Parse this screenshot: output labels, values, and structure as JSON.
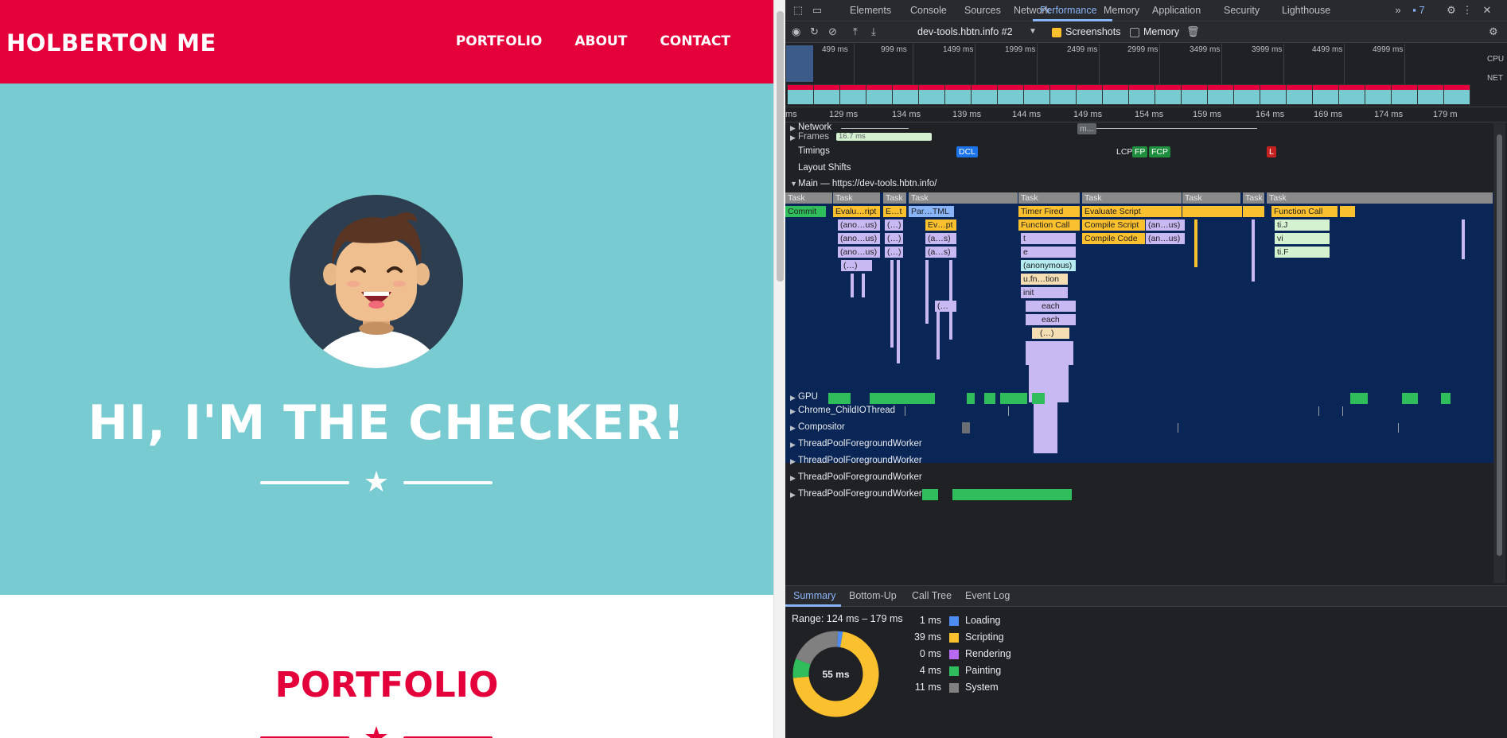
{
  "site": {
    "brand": "HOLBERTON ME",
    "nav": [
      "PORTFOLIO",
      "ABOUT",
      "CONTACT"
    ],
    "hero_title": "HI, I'M THE CHECKER!",
    "section_title": "PORTFOLIO",
    "colors": {
      "primary": "#e3003b",
      "hero_bg": "#78ccd1",
      "avatar_bg": "#2c3e50"
    }
  },
  "devtools": {
    "tabs": [
      "Elements",
      "Console",
      "Sources",
      "Network",
      "Performance",
      "Memory",
      "Application",
      "Security",
      "Lighthouse"
    ],
    "active_tab": "Performance",
    "issues_count": "7",
    "recording_target": "dev-tools.hbtn.info #2",
    "screenshots_label": "Screenshots",
    "screenshots_checked": true,
    "memory_label": "Memory",
    "memory_checked": false,
    "overview_ticks": [
      "499 ms",
      "999 ms",
      "1499 ms",
      "1999 ms",
      "2499 ms",
      "2999 ms",
      "3499 ms",
      "3999 ms",
      "4499 ms",
      "4999 ms"
    ],
    "overview_labels": {
      "cpu": "CPU",
      "net": "NET"
    },
    "ruler_ticks": [
      "ms",
      "129 ms",
      "134 ms",
      "139 ms",
      "144 ms",
      "149 ms",
      "154 ms",
      "159 ms",
      "164 ms",
      "169 ms",
      "174 ms",
      "179 m"
    ],
    "tracks": {
      "network": "Network",
      "network_item": "m...",
      "frames": "Frames",
      "frames_value": "16.7 ms",
      "timings": "Timings",
      "timing_markers": [
        "DCL",
        "LCP",
        "FP",
        "FCP",
        "L"
      ],
      "layout_shifts": "Layout Shifts",
      "main": "Main — https://dev-tools.hbtn.info/",
      "gpu": "GPU",
      "child_io": "Chrome_ChildIOThread",
      "compositor": "Compositor",
      "workers": [
        "ThreadPoolForegroundWorker",
        "ThreadPoolForegroundWorker",
        "ThreadPoolForegroundWorker",
        "ThreadPoolForegroundWorker"
      ]
    },
    "flame": {
      "task": "Task",
      "commit": "Commit",
      "evaluate1": "Evalu…ript",
      "e_t": "E…t",
      "parse_html": "Par…TML",
      "timer_fired": "Timer Fired",
      "evaluate_script": "Evaluate Script",
      "function_call": "Function Call",
      "ano_us": "(ano…us)",
      "ellipsis": "(…)",
      "ev_pt": "Ev…pt",
      "a_s": "(a…s)",
      "t": "t",
      "e": "e",
      "anonymous": "(anonymous)",
      "u_fn_tion": "u.fn…tion",
      "init": "init",
      "each": "each",
      "compile_script": "Compile Script",
      "compile_code": "Compile Code",
      "an_us": "(an…us)",
      "ti_j": "ti.J",
      "vi": "vi",
      "ti_f": "ti.F",
      "dots": "(…"
    },
    "bottom_tabs": [
      "Summary",
      "Bottom-Up",
      "Call Tree",
      "Event Log"
    ],
    "active_bottom_tab": "Summary",
    "range": "Range: 124 ms – 179 ms",
    "total": "55 ms",
    "summary": [
      {
        "ms": "1 ms",
        "label": "Loading",
        "color": "#4d8bf0",
        "value": 1
      },
      {
        "ms": "39 ms",
        "label": "Scripting",
        "color": "#fbc02d",
        "value": 39
      },
      {
        "ms": "0 ms",
        "label": "Rendering",
        "color": "#b96af5",
        "value": 0
      },
      {
        "ms": "4 ms",
        "label": "Painting",
        "color": "#2fbe5b",
        "value": 4
      },
      {
        "ms": "11 ms",
        "label": "System",
        "color": "#808080",
        "value": 11
      }
    ]
  }
}
